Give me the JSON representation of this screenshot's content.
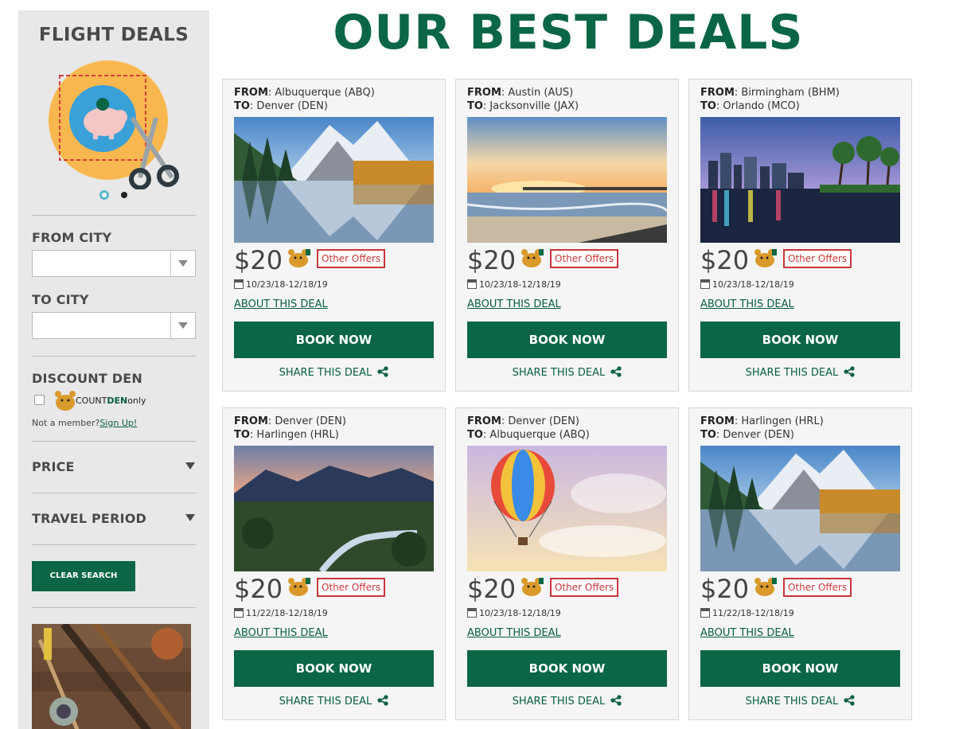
{
  "sidebar": {
    "title": "FLIGHT DEALS",
    "from_label": "FROM CITY",
    "to_label": "TO CITY",
    "discount_label": "DISCOUNT DEN",
    "discount_logo_pre": "COUNT",
    "discount_logo_den": "DEN",
    "discount_logo_post": "only",
    "member_text": "Not a member?",
    "signup_link": "Sign Up!",
    "price_label": "PRICE",
    "travel_label": "TRAVEL PERIOD",
    "clear_button": "CLEAR SEARCH"
  },
  "main": {
    "title": "OUR BEST DEALS",
    "from_key": "FROM",
    "to_key": "TO",
    "deals": [
      {
        "from": ": Albuquerque (ABQ)",
        "to": ": Denver (DEN)",
        "price": "$20",
        "offers": "Other Offers",
        "dates": "10/23/18-12/18/19",
        "about": "ABOUT THIS DEAL",
        "book": "BOOK NOW",
        "share": "SHARE THIS DEAL",
        "scene": "mountain-lake"
      },
      {
        "from": ": Austin (AUS)",
        "to": ": Jacksonville (JAX)",
        "price": "$20",
        "offers": "Other Offers",
        "dates": "10/23/18-12/18/19",
        "about": "ABOUT THIS DEAL",
        "book": "BOOK NOW",
        "share": "SHARE THIS DEAL",
        "scene": "beach-pier"
      },
      {
        "from": ": Birmingham (BHM)",
        "to": ": Orlando (MCO)",
        "price": "$20",
        "offers": "Other Offers",
        "dates": "10/23/18-12/18/19",
        "about": "ABOUT THIS DEAL",
        "book": "BOOK NOW",
        "share": "SHARE THIS DEAL",
        "scene": "city-skyline"
      },
      {
        "from": ": Denver (DEN)",
        "to": ": Harlingen (HRL)",
        "price": "$20",
        "offers": "Other Offers",
        "dates": "11/22/18-12/18/19",
        "about": "ABOUT THIS DEAL",
        "book": "BOOK NOW",
        "share": "SHARE THIS DEAL",
        "scene": "valley-river"
      },
      {
        "from": ": Denver (DEN)",
        "to": ": Albuquerque (ABQ)",
        "price": "$20",
        "offers": "Other Offers",
        "dates": "10/23/18-12/18/19",
        "about": "ABOUT THIS DEAL",
        "book": "BOOK NOW",
        "share": "SHARE THIS DEAL",
        "scene": "hot-air-balloon"
      },
      {
        "from": ": Harlingen (HRL)",
        "to": ": Denver (DEN)",
        "price": "$20",
        "offers": "Other Offers",
        "dates": "11/22/18-12/18/19",
        "about": "ABOUT THIS DEAL",
        "book": "BOOK NOW",
        "share": "SHARE THIS DEAL",
        "scene": "mountain-lake"
      }
    ]
  },
  "colors": {
    "brand_green": "#0a6644",
    "offers_red": "#c9363b",
    "sidebar_bg": "#e8e8e8"
  }
}
